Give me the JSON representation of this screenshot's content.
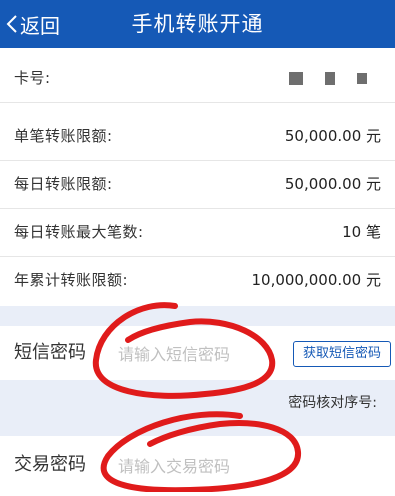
{
  "header": {
    "back_label": "返回",
    "title": "手机转账开通"
  },
  "info_rows": [
    {
      "label": "卡号:",
      "value": ""
    },
    {
      "label": "单笔转账限额:",
      "value": "50,000.00 元"
    },
    {
      "label": "每日转账限额:",
      "value": "50,000.00 元"
    },
    {
      "label": "每日转账最大笔数:",
      "value": "10 笔"
    },
    {
      "label": "年累计转账限额:",
      "value": "10,000,000.00 元"
    }
  ],
  "sms": {
    "label": "短信密码",
    "placeholder": "请输入短信密码",
    "button_label": "获取短信密码"
  },
  "serial_label": "密码核对序号:",
  "trade": {
    "label": "交易密码",
    "placeholder": "请输入交易密码"
  },
  "colors": {
    "header_bg": "#1559b6",
    "section_bg": "#e9eef8",
    "annotation": "#e01b1b"
  },
  "icons": {
    "back": "chevron-left-icon"
  }
}
